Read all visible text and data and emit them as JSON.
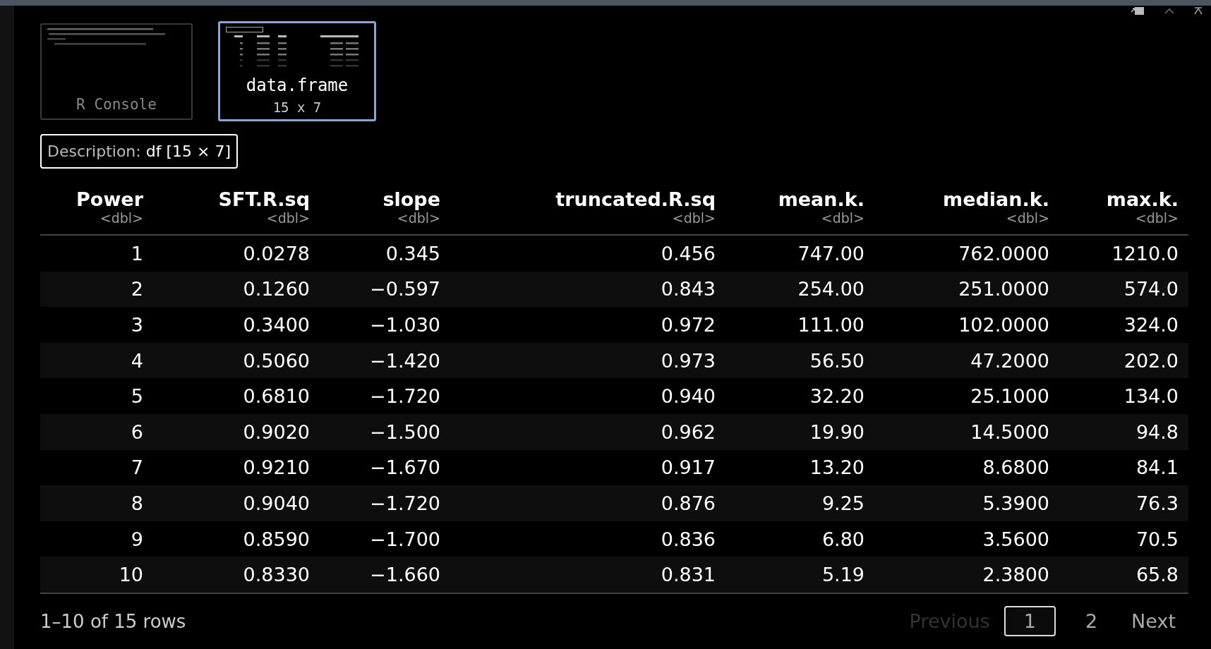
{
  "thumbnails": [
    {
      "kind": "console",
      "selected": false,
      "label": "R Console"
    },
    {
      "kind": "table",
      "selected": true,
      "label": "data.frame",
      "sublabel": "15 x 7"
    }
  ],
  "description": {
    "label": "Description:",
    "value": "df [15 × 7]"
  },
  "table": {
    "columns": [
      {
        "name": "Power",
        "type": "<dbl>"
      },
      {
        "name": "SFT.R.sq",
        "type": "<dbl>"
      },
      {
        "name": "slope",
        "type": "<dbl>"
      },
      {
        "name": "truncated.R.sq",
        "type": "<dbl>"
      },
      {
        "name": "mean.k.",
        "type": "<dbl>"
      },
      {
        "name": "median.k.",
        "type": "<dbl>"
      },
      {
        "name": "max.k.",
        "type": "<dbl>"
      }
    ],
    "rows": [
      [
        "1",
        "0.0278",
        "0.345",
        "0.456",
        "747.00",
        "762.0000",
        "1210.0"
      ],
      [
        "2",
        "0.1260",
        "−0.597",
        "0.843",
        "254.00",
        "251.0000",
        "574.0"
      ],
      [
        "3",
        "0.3400",
        "−1.030",
        "0.972",
        "111.00",
        "102.0000",
        "324.0"
      ],
      [
        "4",
        "0.5060",
        "−1.420",
        "0.973",
        "56.50",
        "47.2000",
        "202.0"
      ],
      [
        "5",
        "0.6810",
        "−1.720",
        "0.940",
        "32.20",
        "25.1000",
        "134.0"
      ],
      [
        "6",
        "0.9020",
        "−1.500",
        "0.962",
        "19.90",
        "14.5000",
        "94.8"
      ],
      [
        "7",
        "0.9210",
        "−1.670",
        "0.917",
        "13.20",
        "8.6800",
        "84.1"
      ],
      [
        "8",
        "0.9040",
        "−1.720",
        "0.876",
        "9.25",
        "5.3900",
        "76.3"
      ],
      [
        "9",
        "0.8590",
        "−1.700",
        "0.836",
        "6.80",
        "3.5600",
        "70.5"
      ],
      [
        "10",
        "0.8330",
        "−1.660",
        "0.831",
        "5.19",
        "2.3800",
        "65.8"
      ]
    ]
  },
  "footer": {
    "summary": "1–10 of 15 rows",
    "previous": {
      "label": "Previous",
      "disabled": true
    },
    "pages": [
      {
        "label": "1",
        "selected": true
      },
      {
        "label": "2",
        "selected": false
      }
    ],
    "next": {
      "label": "Next",
      "disabled": false
    }
  }
}
